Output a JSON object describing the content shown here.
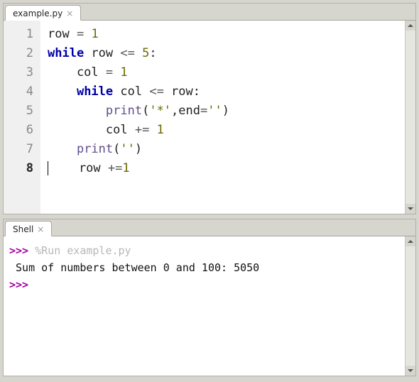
{
  "editor": {
    "tab_label": "example.py",
    "current_line": 8,
    "lines": [
      {
        "n": 1,
        "tokens": [
          [
            "txt",
            "row "
          ],
          [
            "op",
            "="
          ],
          [
            "txt",
            " "
          ],
          [
            "num",
            "1"
          ]
        ]
      },
      {
        "n": 2,
        "tokens": [
          [
            "kw",
            "while"
          ],
          [
            "txt",
            " row "
          ],
          [
            "op",
            "<="
          ],
          [
            "txt",
            " "
          ],
          [
            "num",
            "5"
          ],
          [
            "txt",
            ":"
          ]
        ]
      },
      {
        "n": 3,
        "tokens": [
          [
            "txt",
            "    col "
          ],
          [
            "op",
            "="
          ],
          [
            "txt",
            " "
          ],
          [
            "num",
            "1"
          ]
        ]
      },
      {
        "n": 4,
        "tokens": [
          [
            "txt",
            "    "
          ],
          [
            "kw",
            "while"
          ],
          [
            "txt",
            " col "
          ],
          [
            "op",
            "<="
          ],
          [
            "txt",
            " row:"
          ]
        ]
      },
      {
        "n": 5,
        "tokens": [
          [
            "txt",
            "        "
          ],
          [
            "fn",
            "print"
          ],
          [
            "txt",
            "("
          ],
          [
            "str",
            "'*'"
          ],
          [
            "txt",
            ",end"
          ],
          [
            "op",
            "="
          ],
          [
            "str",
            "''"
          ],
          [
            "txt",
            ")"
          ]
        ]
      },
      {
        "n": 6,
        "tokens": [
          [
            "txt",
            "        col "
          ],
          [
            "op",
            "+="
          ],
          [
            "txt",
            " "
          ],
          [
            "num",
            "1"
          ]
        ]
      },
      {
        "n": 7,
        "tokens": [
          [
            "txt",
            "    "
          ],
          [
            "fn",
            "print"
          ],
          [
            "txt",
            "("
          ],
          [
            "str",
            "''"
          ],
          [
            "txt",
            ")"
          ]
        ]
      },
      {
        "n": 8,
        "tokens": [
          [
            "txt",
            "    row "
          ],
          [
            "op",
            "+="
          ],
          [
            "num",
            "1"
          ]
        ]
      }
    ]
  },
  "shell": {
    "tab_label": "Shell",
    "prompt": ">>>",
    "run_command": "%Run example.py",
    "output": " Sum of numbers between 0 and 100: 5050"
  }
}
